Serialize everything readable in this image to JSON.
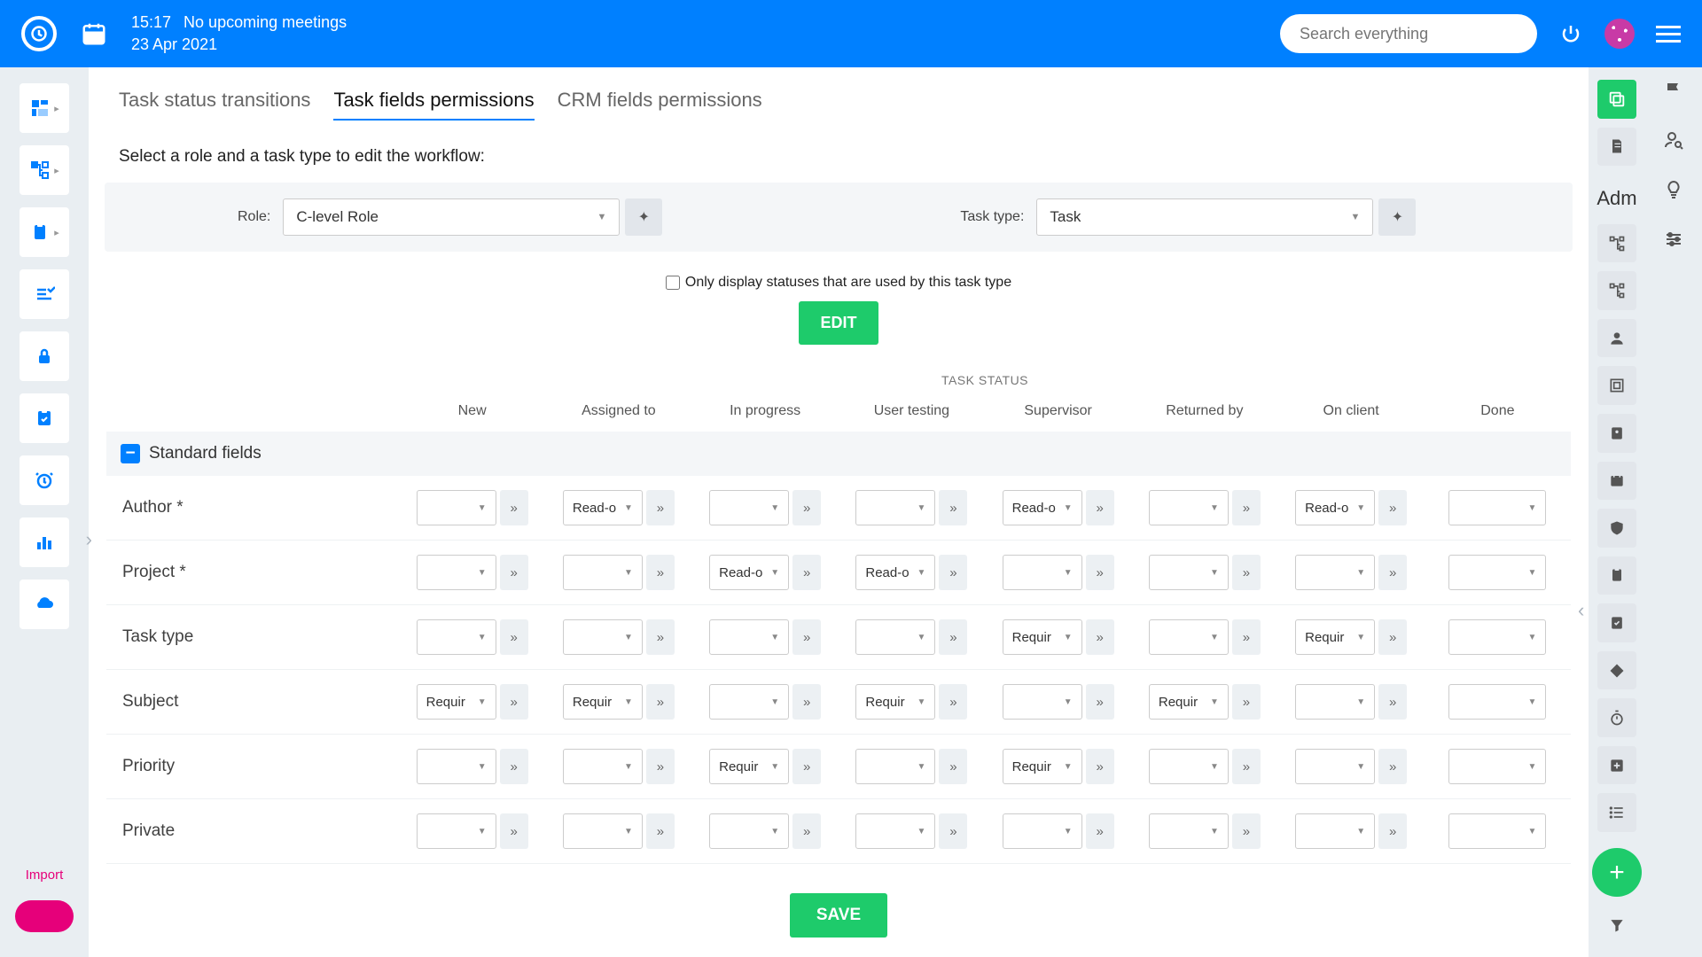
{
  "header": {
    "time": "15:17",
    "meeting": "No upcoming meetings",
    "date": "23 Apr 2021",
    "search_placeholder": "Search everything"
  },
  "tabs": [
    {
      "id": "status",
      "label": "Task status transitions",
      "active": false
    },
    {
      "id": "fields",
      "label": "Task fields permissions",
      "active": true
    },
    {
      "id": "crm",
      "label": "CRM fields permissions",
      "active": false
    }
  ],
  "instruction": "Select a role and a task type to edit the workflow:",
  "selector": {
    "role_label": "Role:",
    "role_value": "C-level Role",
    "tasktype_label": "Task type:",
    "tasktype_value": "Task"
  },
  "filter": {
    "label": "Only display statuses that are used by this task type",
    "checked": false
  },
  "buttons": {
    "edit": "EDIT",
    "save": "SAVE"
  },
  "grid": {
    "super_header": "TASK STATUS",
    "columns": [
      "New",
      "Assigned to",
      "In progress",
      "User testing",
      "Supervisor",
      "Returned by",
      "On client",
      "Done"
    ],
    "section_label": "Standard fields",
    "rows": [
      {
        "name": "Author *",
        "cells": [
          "",
          "Read-o",
          "",
          "",
          "Read-o",
          "",
          "Read-o",
          ""
        ]
      },
      {
        "name": "Project *",
        "cells": [
          "",
          "",
          "Read-o",
          "Read-o",
          "",
          "",
          "",
          ""
        ]
      },
      {
        "name": "Task type",
        "cells": [
          "",
          "",
          "",
          "",
          "Requir",
          "",
          "Requir",
          ""
        ]
      },
      {
        "name": "Subject",
        "cells": [
          "Requir",
          "Requir",
          "",
          "Requir",
          "",
          "Requir",
          "",
          ""
        ]
      },
      {
        "name": "Priority",
        "cells": [
          "",
          "",
          "Requir",
          "",
          "Requir",
          "",
          "",
          ""
        ]
      },
      {
        "name": "Private",
        "cells": [
          "",
          "",
          "",
          "",
          "",
          "",
          "",
          ""
        ]
      }
    ]
  },
  "right_label": "Adm",
  "import_text": "Import"
}
